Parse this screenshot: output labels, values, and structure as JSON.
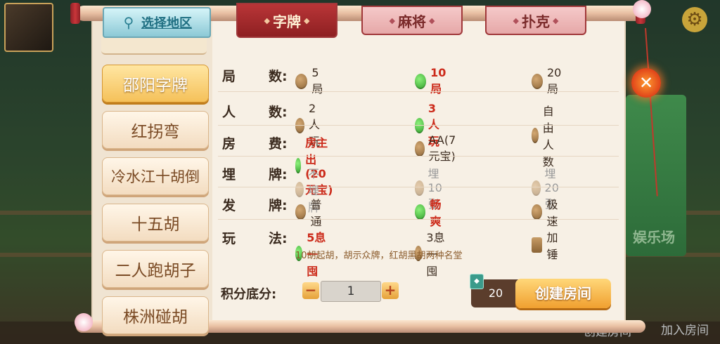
{
  "location_tab": {
    "label": "选择地区"
  },
  "category_tabs": [
    {
      "label": "字牌",
      "selected": true
    },
    {
      "label": "麻将",
      "selected": false
    },
    {
      "label": "扑克",
      "selected": false
    }
  ],
  "games": [
    {
      "label": "邵阳字牌",
      "selected": true
    },
    {
      "label": "红拐弯",
      "selected": false
    },
    {
      "label": "冷水江十胡倒",
      "selected": false
    },
    {
      "label": "十五胡",
      "selected": false
    },
    {
      "label": "二人跑胡子",
      "selected": false
    },
    {
      "label": "株洲碰胡",
      "selected": false
    }
  ],
  "options": {
    "rounds": {
      "label_a": "局",
      "label_b": "数:",
      "choices": [
        "5局",
        "10局",
        "20局"
      ],
      "selected": 1
    },
    "players": {
      "label_a": "人",
      "label_b": "数:",
      "choices": [
        "2人玩",
        "3人玩",
        "自由人数"
      ],
      "selected": 1
    },
    "fee": {
      "label_a": "房",
      "label_b": "费:",
      "choices": [
        "房主出(20元宝)",
        "AA(7元宝)"
      ],
      "selected": 0
    },
    "bury": {
      "label_a": "埋",
      "label_b": "牌:",
      "choices": [
        "不埋牌",
        "埋10张",
        "埋20张"
      ],
      "selected": 0
    },
    "deal": {
      "label_a": "发",
      "label_b": "牌:",
      "choices": [
        "普通",
        "畅爽",
        "极速"
      ],
      "selected": 1
    },
    "play": {
      "label_a": "玩",
      "label_b": "法:",
      "choices": [
        "5息一囤",
        "3息一囤",
        "加锤"
      ],
      "selected": 0,
      "note": "10胡起胡，胡示众牌，红胡黑胡两种名堂"
    }
  },
  "score": {
    "label": "积分底分:",
    "value": "1",
    "minus": "−",
    "plus": "+"
  },
  "create": {
    "cost": "20",
    "label": "创建房间"
  },
  "close_glyph": "✕",
  "background": {
    "join_room": "加入房间",
    "create_room": "创建房间",
    "right_text": "娱乐场"
  }
}
